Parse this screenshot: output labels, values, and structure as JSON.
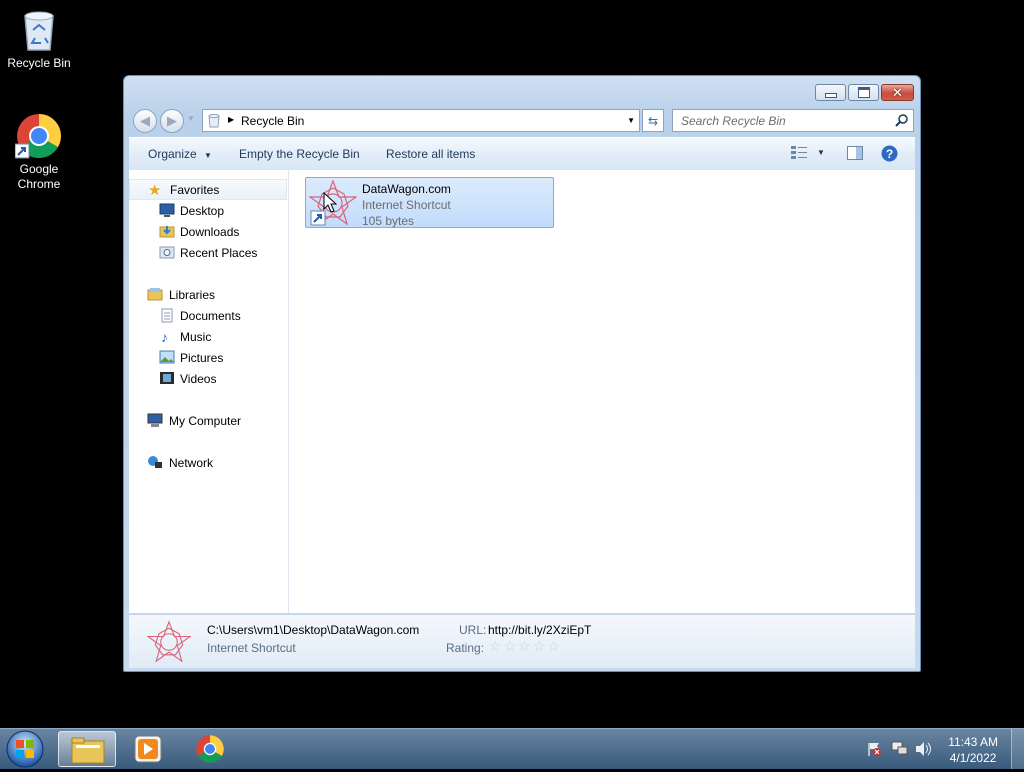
{
  "desktop": {
    "icons": [
      {
        "label": "Recycle Bin",
        "icon": "recycle-bin-icon"
      },
      {
        "label": "Google Chrome",
        "icon": "chrome-icon"
      }
    ]
  },
  "window": {
    "address": {
      "location": "Recycle Bin"
    },
    "search": {
      "placeholder": "Search Recycle Bin"
    },
    "commands": {
      "organize": "Organize",
      "empty": "Empty the Recycle Bin",
      "restore": "Restore all items"
    },
    "nav": {
      "favorites": "Favorites",
      "desktop": "Desktop",
      "downloads": "Downloads",
      "recent": "Recent Places",
      "libraries": "Libraries",
      "documents": "Documents",
      "music": "Music",
      "pictures": "Pictures",
      "videos": "Videos",
      "computer": "My Computer",
      "network": "Network"
    },
    "file": {
      "name": "DataWagon.com",
      "type": "Internet Shortcut",
      "size": "105 bytes"
    },
    "details": {
      "path": "C:\\Users\\vm1\\Desktop\\DataWagon.com",
      "type": "Internet Shortcut",
      "url_label": "URL:",
      "url_value": "http://bit.ly/2XziEpT",
      "rating_label": "Rating:",
      "rating_stars": 0
    }
  },
  "taskbar": {
    "time": "11:43 AM",
    "date": "4/1/2022"
  },
  "colors": {
    "accent": "#1e395b",
    "selection": "#c1dcfc",
    "close": "#c74d3a"
  }
}
